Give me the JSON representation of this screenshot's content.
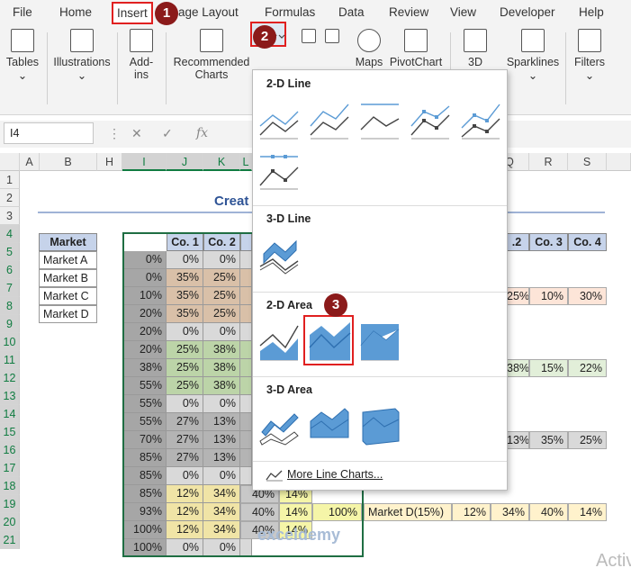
{
  "menu": {
    "tabs": [
      "File",
      "Home",
      "Insert",
      "age Layout",
      "Formulas",
      "Data",
      "Review",
      "View",
      "Developer",
      "Help"
    ]
  },
  "steps": [
    "1",
    "2",
    "3"
  ],
  "ribbon": {
    "tables": "Tables",
    "illustrations": "Illustrations",
    "addins": "Add-ins",
    "recommended": "Recommended",
    "recommended2": "Charts",
    "maps": "Maps",
    "pivotchart": "PivotChart",
    "threed": "3D",
    "sparklines": "Sparklines",
    "filters": "Filters"
  },
  "formula_bar": {
    "name_box": "I4",
    "fx": "fx"
  },
  "columns": [
    "A",
    "B",
    "H",
    "I",
    "J",
    "K",
    "L",
    "Q",
    "R",
    "S"
  ],
  "rows": [
    "1",
    "2",
    "3",
    "4",
    "5",
    "6",
    "7",
    "8",
    "9",
    "10",
    "11",
    "12",
    "13",
    "14",
    "15",
    "16",
    "17",
    "18",
    "19",
    "20",
    "21"
  ],
  "sheet": {
    "title_visible": "Creat",
    "market_header": "Market",
    "markets": [
      "Market A",
      "Market B",
      "Market C",
      "Market D"
    ],
    "selected_headers": [
      "Co. 1",
      "Co. 2"
    ],
    "col_i": [
      "0%",
      "0%",
      "10%",
      "20%",
      "20%",
      "20%",
      "38%",
      "55%",
      "55%",
      "55%",
      "70%",
      "85%",
      "85%",
      "85%",
      "93%",
      "100%",
      "100%"
    ],
    "col_j": [
      "0%",
      "35%",
      "35%",
      "35%",
      "0%",
      "25%",
      "25%",
      "25%",
      "0%",
      "27%",
      "27%",
      "27%",
      "0%",
      "12%",
      "12%",
      "12%",
      "0%"
    ],
    "col_k": [
      "0%",
      "25%",
      "25%",
      "25%",
      "0%",
      "38%",
      "38%",
      "38%",
      "0%",
      "13%",
      "13%",
      "13%",
      "0%",
      "34%",
      "34%",
      "34%",
      "0%"
    ],
    "row18_extra": [
      "40%",
      "14%"
    ],
    "row19_extra": [
      "40%",
      "14%",
      "100%"
    ],
    "row20_extra": [
      "40%",
      "14%"
    ],
    "right_headers": [
      ".2",
      "Co. 3",
      "Co. 4"
    ],
    "right_row7": [
      "25%",
      "10%",
      "30%"
    ],
    "right_row11": [
      "38%",
      "15%",
      "22%"
    ],
    "right_row15": [
      "13%",
      "35%",
      "25%"
    ],
    "right_row19": [
      "Market D(15%)",
      "12%",
      "34%",
      "40%",
      "14%"
    ]
  },
  "dropdown": {
    "sec_2d_line": "2-D Line",
    "sec_3d_line": "3-D Line",
    "sec_2d_area": "2-D Area",
    "sec_3d_area": "3-D Area",
    "more": "More Line Charts..."
  },
  "watermark": "exceldemy",
  "activate": "Activ"
}
